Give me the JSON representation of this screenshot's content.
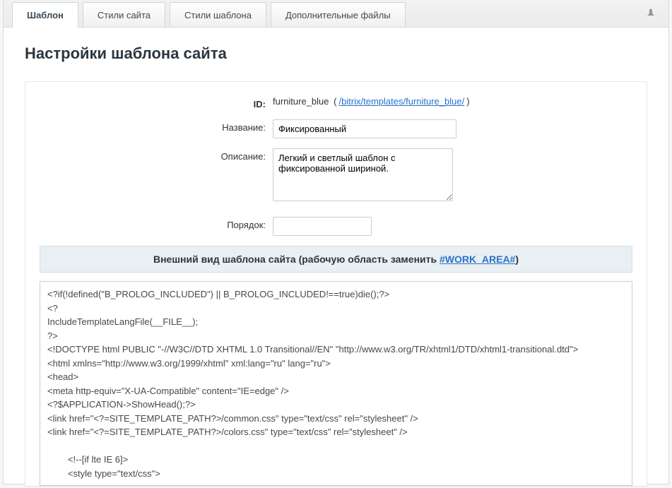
{
  "tabs": {
    "template": "Шаблон",
    "site_styles": "Стили сайта",
    "template_styles": "Стили шаблона",
    "additional_files": "Дополнительные файлы"
  },
  "page_title": "Настройки шаблона сайта",
  "form": {
    "id_label": "ID:",
    "id_value": "furniture_blue",
    "id_link_text": "/bitrix/templates/furniture_blue/",
    "name_label": "Название:",
    "name_value": "Фиксированный",
    "description_label": "Описание:",
    "description_value": "Легкий и светлый шаблон с фиксированной шириной.",
    "order_label": "Порядок:",
    "order_value": ""
  },
  "section": {
    "header_prefix": "Внешний вид шаблона сайта (рабочую область заменить ",
    "header_link": "#WORK_AREA#",
    "header_suffix": ")"
  },
  "code": "<?if(!defined(\"B_PROLOG_INCLUDED\") || B_PROLOG_INCLUDED!==true)die();?>\n<?\nIncludeTemplateLangFile(__FILE__);\n?>\n<!DOCTYPE html PUBLIC \"-//W3C//DTD XHTML 1.0 Transitional//EN\" \"http://www.w3.org/TR/xhtml1/DTD/xhtml1-transitional.dtd\">\n<html xmlns=\"http://www.w3.org/1999/xhtml\" xml:lang=\"ru\" lang=\"ru\">\n<head>\n<meta http-equiv=\"X-UA-Compatible\" content=\"IE=edge\" />\n<?$APPLICATION->ShowHead();?>\n<link href=\"<?=SITE_TEMPLATE_PATH?>/common.css\" type=\"text/css\" rel=\"stylesheet\" />\n<link href=\"<?=SITE_TEMPLATE_PATH?>/colors.css\" type=\"text/css\" rel=\"stylesheet\" />\n\n        <!--[if lte IE 6]>\n        <style type=\"text/css\">\n\n                #banner-overlay {\n                        background-image: none;"
}
